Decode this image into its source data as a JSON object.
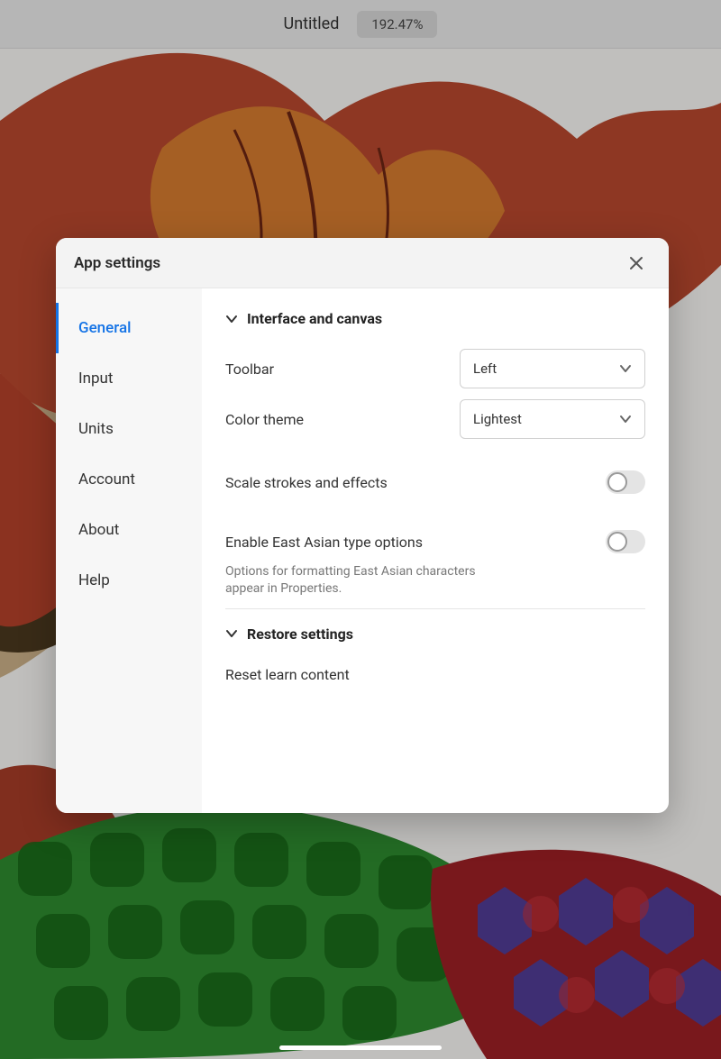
{
  "header": {
    "document_title": "Untitled",
    "zoom": "192.47%"
  },
  "modal": {
    "title": "App settings",
    "sidebar": {
      "items": [
        {
          "label": "General",
          "active": true
        },
        {
          "label": "Input",
          "active": false
        },
        {
          "label": "Units",
          "active": false
        },
        {
          "label": "Account",
          "active": false
        },
        {
          "label": "About",
          "active": false
        },
        {
          "label": "Help",
          "active": false
        }
      ]
    },
    "content": {
      "interface_section": {
        "title": "Interface and canvas",
        "rows": {
          "toolbar": {
            "label": "Toolbar",
            "value": "Left"
          },
          "color_theme": {
            "label": "Color theme",
            "value": "Lightest"
          },
          "scale_strokes": {
            "label": "Scale strokes and effects",
            "enabled": false
          },
          "east_asian": {
            "label": "Enable East Asian type options",
            "description": "Options for formatting East Asian characters appear in Properties.",
            "enabled": false
          }
        }
      },
      "restore_section": {
        "title": "Restore settings",
        "reset_label": "Reset learn content"
      }
    }
  }
}
